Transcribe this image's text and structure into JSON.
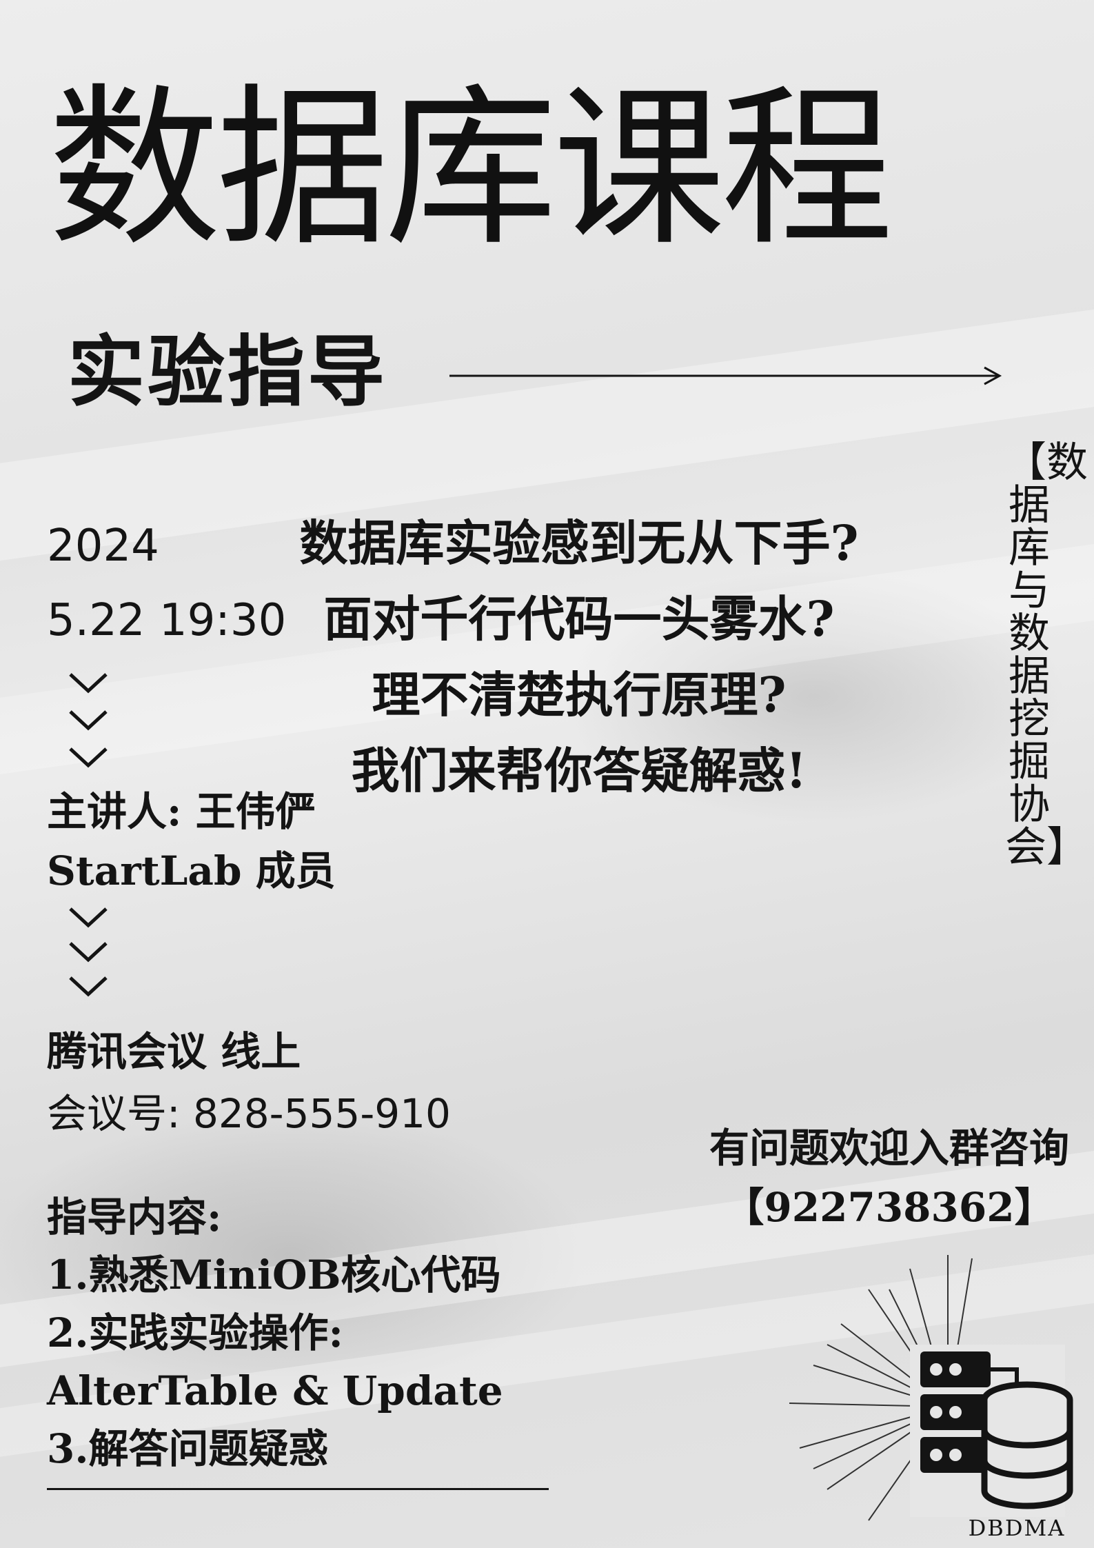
{
  "title": "数据库课程",
  "subtitle": "实验指导",
  "side_banner": "【数据库与数据挖掘协会】",
  "event": {
    "year": "2024",
    "datetime": "5.22   19:30"
  },
  "questions": [
    "数据库实验感到无从下手?",
    "面对千行代码一头雾水?",
    "理不清楚执行原理?",
    "我们来帮你答疑解惑!"
  ],
  "speaker": {
    "line1": "主讲人: 王伟俨",
    "line2": "StartLab 成员"
  },
  "meeting": {
    "platform": "腾讯会议 线上",
    "number": "会议号: 828-555-910"
  },
  "content": {
    "heading": "指导内容:",
    "items": [
      "1.熟悉MiniOB核心代码",
      "2.实践实验操作:",
      "AlterTable & Update",
      "3.解答问题疑惑"
    ]
  },
  "contact": {
    "line1": "有问题欢迎入群咨询",
    "line2": "【922738362】"
  },
  "logo": {
    "text": "DBDMA",
    "icon": "database-server-icon"
  },
  "colors": {
    "ink": "#141414",
    "background": "#e6e6e6"
  }
}
